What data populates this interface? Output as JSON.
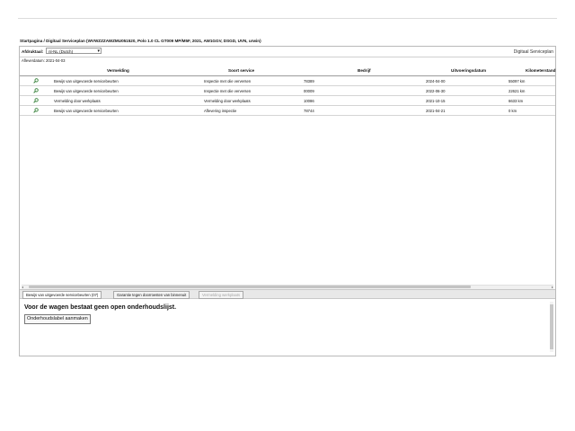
{
  "breadcrumb": "Startpagina / Digitaal Serviceplan (WVWZZZAWZMU051520, Polo 1.0 CL GT009 MP/M5F, 2021, AW1GGV, DSGD, UVN, urwin)",
  "toolbar": {
    "print_label": "Afdruktaal:",
    "language_value": "nl-NL (Dutch)",
    "title": "Digitaal Serviceplan"
  },
  "date_line": "Afleverdatum: 2021-04-03",
  "table": {
    "headers": [
      "Vermelding",
      "Soort service",
      "Bedrijf",
      "Uitvoeringsdatum",
      "Kilometerstand"
    ],
    "rows": [
      [
        "Bewijs van uitgevoerde servicebeurten",
        "Inspectie met olie verversen",
        "78389",
        "2024-04-00",
        "55097 km"
      ],
      [
        "Bewijs van uitgevoerde servicebeurten",
        "Inspectie met olie verversen",
        "00009",
        "2022-06-30",
        "22621 km"
      ],
      [
        "Vermelding door werkplaats",
        "Vermelding door werkplaats",
        "10086",
        "2021-10-15",
        "6633 km"
      ],
      [
        "Bewijs van uitgevoerde servicebeurten",
        "Aflevering inspectie",
        "78744",
        "2021-04-21",
        "0 km"
      ]
    ]
  },
  "tabs": [
    {
      "label": "Bewijs van uitgevoerde servicebeurten (07)",
      "state": "active"
    },
    {
      "label": "Garantie tegen doorroesten van binnenuit",
      "state": "normal"
    },
    {
      "label": "Vermelding werkplaats",
      "state": "disabled"
    }
  ],
  "panel": {
    "message": "Voor de wagen bestaat geen open onderhoudslijst.",
    "button_label": "Onderhoudslabel aanmaken"
  },
  "icons": {
    "row_detail": "magnifier-icon"
  },
  "colors": {
    "icon_green": "#2e7d32"
  }
}
